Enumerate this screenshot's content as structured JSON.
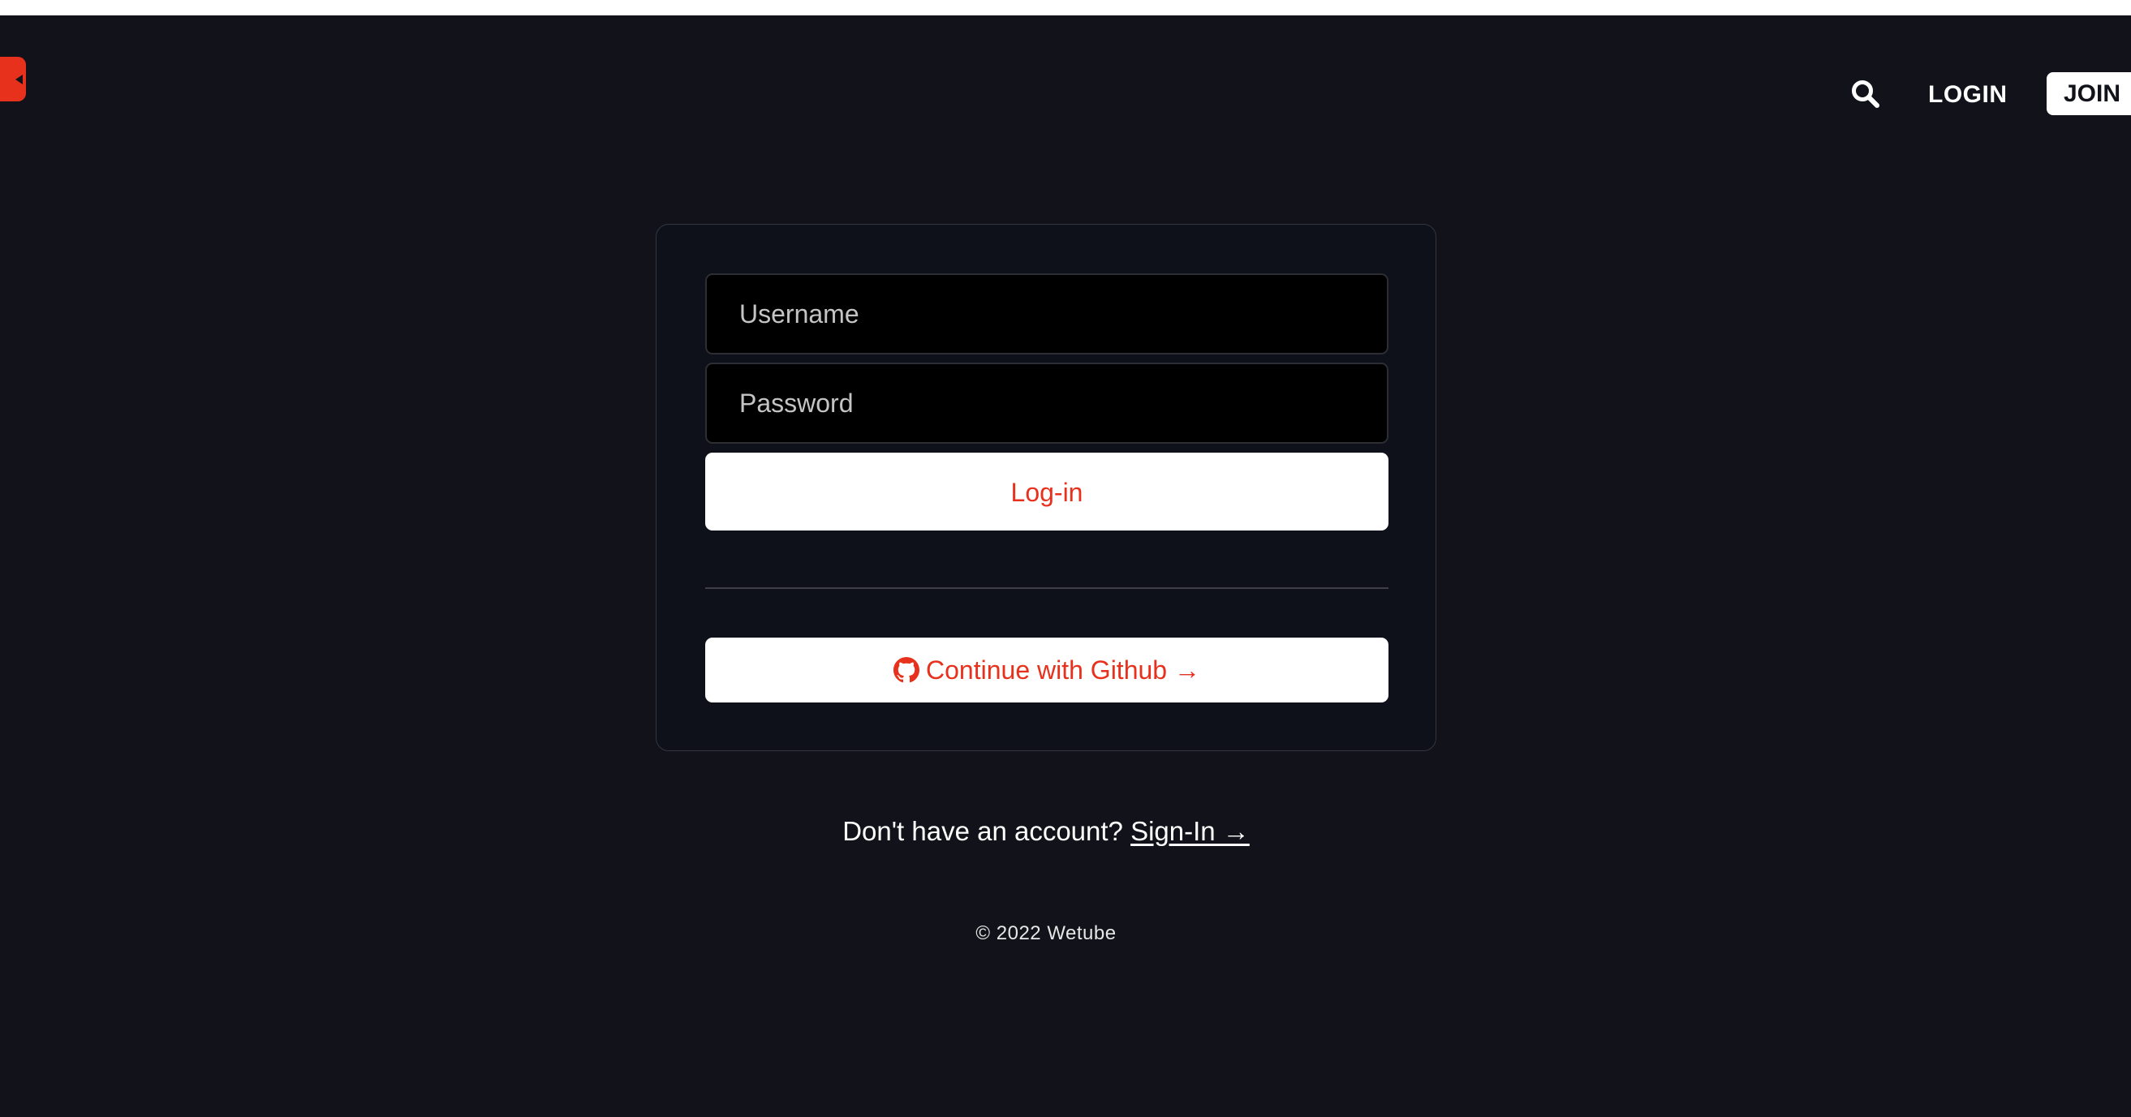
{
  "header": {
    "logo_icon": "play-icon",
    "search_icon": "search-icon",
    "login_label": "LOGIN",
    "join_label": "JOIN",
    "accent_color": "#e8311d"
  },
  "login_form": {
    "username_placeholder": "Username",
    "password_placeholder": "Password",
    "submit_label": "Log-in",
    "github_icon": "github-icon",
    "github_label": "Continue with Github →"
  },
  "signup": {
    "prompt": "Don't have an account?",
    "link_label": "Sign-In →"
  },
  "footer": {
    "copyright": "© 2022 Wetube"
  }
}
